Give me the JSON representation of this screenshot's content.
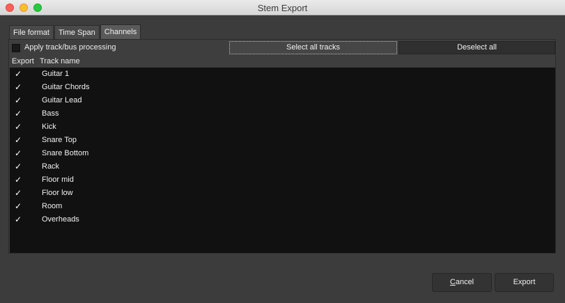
{
  "window": {
    "title": "Stem Export"
  },
  "tabs": [
    {
      "label": "File format"
    },
    {
      "label": "Time Span"
    },
    {
      "label": "Channels"
    }
  ],
  "toolbar": {
    "apply_processing_label": "Apply track/bus processing",
    "apply_processing_checked": false,
    "select_all_label": "Select all tracks",
    "deselect_all_label": "Deselect all"
  },
  "table": {
    "headers": {
      "export": "Export",
      "track_name": "Track name"
    },
    "check_glyph": "✓",
    "rows": [
      {
        "name": "Guitar 1",
        "export": true
      },
      {
        "name": "Guitar Chords",
        "export": true
      },
      {
        "name": "Guitar Lead",
        "export": true
      },
      {
        "name": "Bass",
        "export": true
      },
      {
        "name": "Kick",
        "export": true
      },
      {
        "name": "Snare Top",
        "export": true
      },
      {
        "name": "Snare Bottom",
        "export": true
      },
      {
        "name": "Rack",
        "export": true
      },
      {
        "name": "Floor mid",
        "export": true
      },
      {
        "name": "Floor low",
        "export": true
      },
      {
        "name": "Room",
        "export": true
      },
      {
        "name": "Overheads",
        "export": true
      }
    ]
  },
  "footer": {
    "cancel_label": "Cancel",
    "export_label": "Export"
  }
}
